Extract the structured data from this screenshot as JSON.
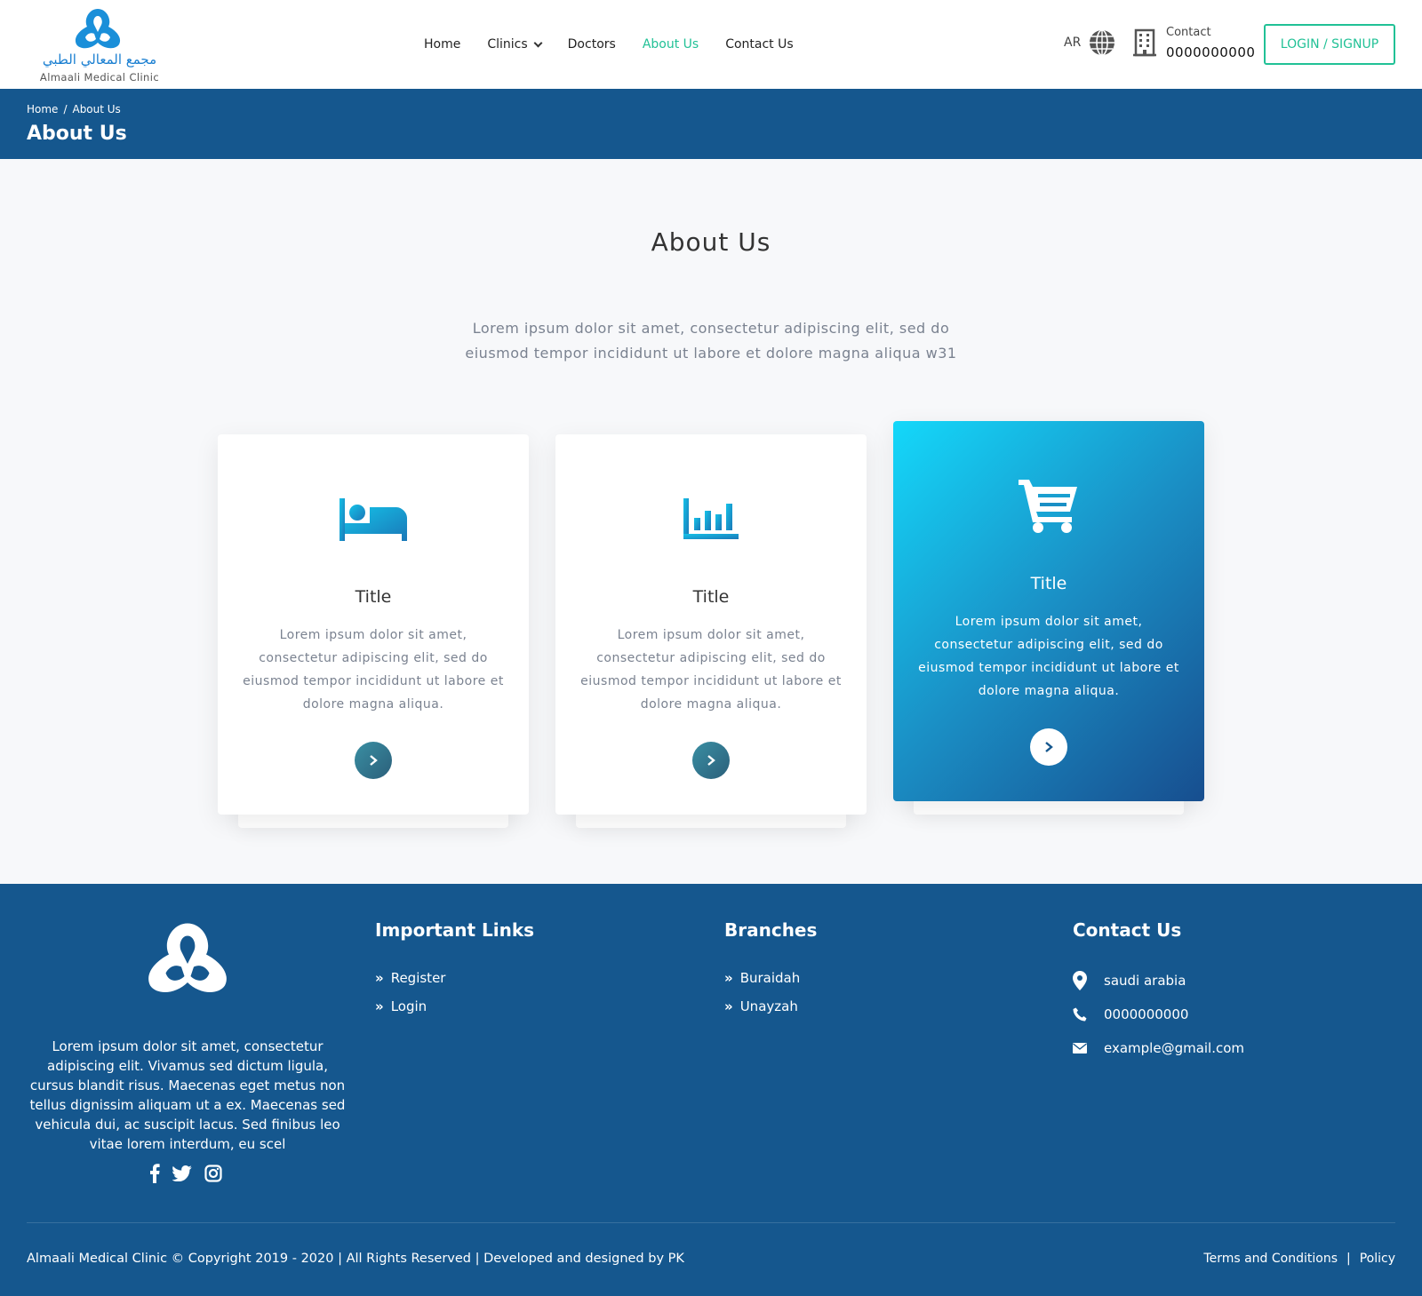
{
  "header": {
    "logo_ar": "مجمع المعالي الطبي",
    "logo_en": "Almaali Medical Clinic",
    "nav": [
      {
        "label": "Home"
      },
      {
        "label": "Clinics"
      },
      {
        "label": "Doctors"
      },
      {
        "label": "About Us",
        "active": true
      },
      {
        "label": "Contact Us"
      }
    ],
    "lang": "AR",
    "contact_label": "Contact",
    "contact_number": "0000000000",
    "login_label": "LOGIN / SIGNUP"
  },
  "banner": {
    "breadcrumb": [
      "Home",
      "/",
      "About Us"
    ],
    "title": "About Us"
  },
  "main": {
    "title": "About Us",
    "description": "Lorem ipsum dolor sit amet, consectetur adipiscing elit, sed do eiusmod tempor incididunt ut labore et dolore magna aliqua w31",
    "cards": [
      {
        "icon": "bed-icon",
        "title": "Title",
        "text": "Lorem ipsum dolor sit amet, consectetur adipiscing elit, sed do eiusmod tempor incididunt ut labore et dolore magna aliqua."
      },
      {
        "icon": "bar-chart-icon",
        "title": "Title",
        "text": "Lorem ipsum dolor sit amet, consectetur adipiscing elit, sed do eiusmod tempor incididunt ut labore et dolore magna aliqua."
      },
      {
        "icon": "cart-icon",
        "title": "Title",
        "text": "Lorem ipsum dolor sit amet, consectetur adipiscing elit, sed do eiusmod tempor incididunt ut labore et dolore magna aliqua.",
        "active": true
      }
    ]
  },
  "footer": {
    "about": "Lorem ipsum dolor sit amet, consectetur adipiscing elit. Vivamus sed dictum ligula, cursus blandit risus. Maecenas eget metus non tellus dignissim aliquam ut a ex. Maecenas sed vehicula dui, ac suscipit lacus. Sed finibus leo vitae lorem interdum, eu scel",
    "social": [
      "facebook-icon",
      "twitter-icon",
      "instagram-icon"
    ],
    "links_title": "Important Links",
    "links": [
      "Register",
      "Login"
    ],
    "branches_title": "Branches",
    "branches": [
      "Buraidah",
      "Unayzah"
    ],
    "contact_title": "Contact Us",
    "contact": {
      "address": "saudi arabia",
      "phone": "0000000000",
      "email": "example@gmail.com"
    },
    "copyright": "Almaali Medical Clinic © Copyright 2019 - 2020 | All Rights Reserved | Developed and designed by PK",
    "terms": "Terms and Conditions",
    "separator": "|",
    "policy": "Policy"
  },
  "colors": {
    "primary_blue": "#15578e",
    "accent_green": "#21c196",
    "card_icon_blue": "#1a8fc5"
  }
}
